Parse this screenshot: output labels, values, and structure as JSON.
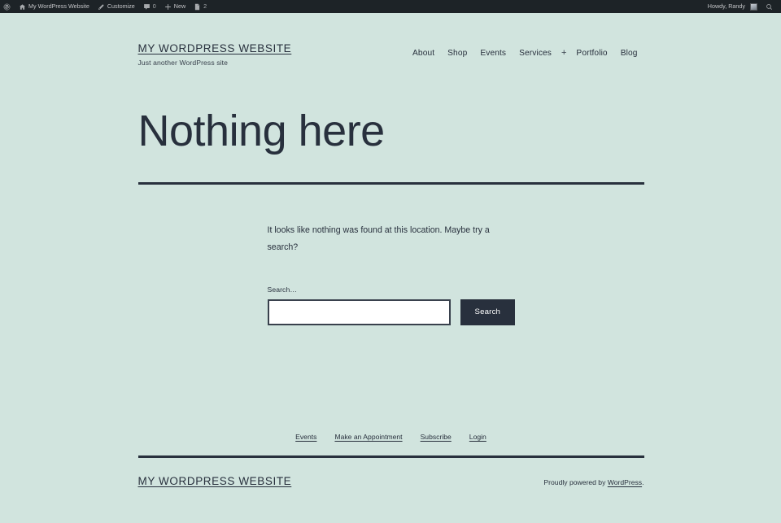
{
  "theme": {
    "background": "#d1e4de",
    "foreground": "#28303d",
    "adminbar_background": "#1d2327",
    "adminbar_foreground": "#c3c4c7",
    "button_background": "#28303d",
    "button_foreground": "#ffffff",
    "input_background": "#ffffff"
  },
  "adminbar": {
    "wp_logo_label": "W",
    "site_name": "My WordPress Website",
    "customize_label": "Customize",
    "comments_count": "0",
    "new_label": "New",
    "updates_count": "2",
    "howdy": "Howdy, Randy",
    "search_icon": "search-icon"
  },
  "header": {
    "site_title": "MY WORDPRESS WEBSITE",
    "tagline": "Just another WordPress site",
    "nav": [
      {
        "label": "About"
      },
      {
        "label": "Shop"
      },
      {
        "label": "Events"
      },
      {
        "label": "Services"
      },
      {
        "label": "Portfolio"
      },
      {
        "label": "Blog"
      }
    ],
    "submenu_toggle": "+"
  },
  "main": {
    "page_title": "Nothing here",
    "message": "It looks like nothing was found at this location. Maybe try a search?",
    "search": {
      "label": "Search…",
      "value": "",
      "placeholder": "",
      "button_label": "Search"
    }
  },
  "footer": {
    "nav": [
      {
        "label": "Events"
      },
      {
        "label": "Make an Appointment"
      },
      {
        "label": "Subscribe"
      },
      {
        "label": "Login"
      }
    ],
    "site_title": "MY WORDPRESS WEBSITE",
    "credit_prefix": "Proudly powered by ",
    "credit_link": "WordPress",
    "credit_suffix": "."
  }
}
